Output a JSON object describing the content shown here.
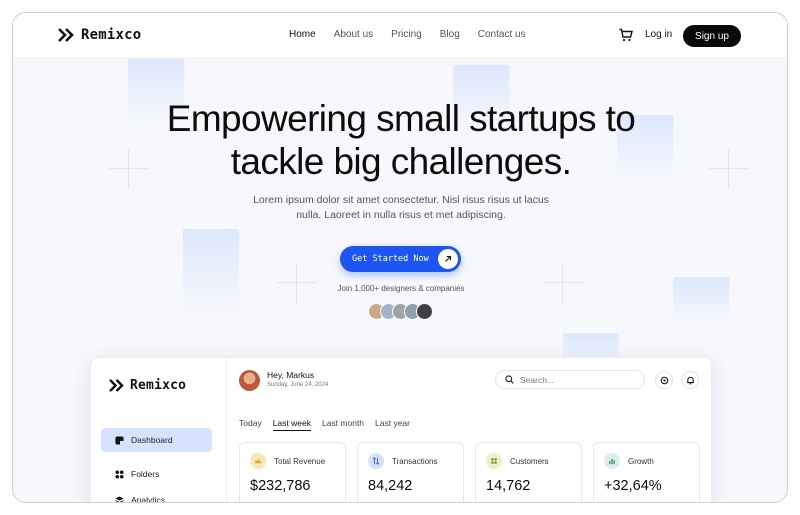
{
  "brand": {
    "name": "Remixco"
  },
  "nav": {
    "links": [
      "Home",
      "About us",
      "Pricing",
      "Blog",
      "Contact us"
    ],
    "active": "Home",
    "cart_icon": "cart-icon",
    "login": "Log in",
    "signup": "Sign up"
  },
  "hero": {
    "title_line1": "Empowering small startups to",
    "title_line2": "tackle big challenges.",
    "subtitle_line1": "Lorem ipsum dolor sit amet consectetur. Nisl risus risus ut lacus",
    "subtitle_line2": "nulla. Laoreet in nulla risus et met adipiscing.",
    "cta": "Get Started Now",
    "cta_icon": "arrow-up-right-icon",
    "join_text": "Join 1,000+ designers & companies",
    "avatar_count": 5
  },
  "dashboard": {
    "brand": "Remixco",
    "user": {
      "greeting": "Hey, Markus",
      "date": "Sunday, June 24, 2024"
    },
    "search_placeholder": "Search...",
    "sidebar": [
      {
        "label": "Dashboard",
        "icon": "dashboard-icon",
        "active": true
      },
      {
        "label": "Folders",
        "icon": "folders-icon",
        "active": false
      },
      {
        "label": "Analytics",
        "icon": "analytics-icon",
        "active": false
      }
    ],
    "tabs": [
      "Today",
      "Last week",
      "Last month",
      "Last year"
    ],
    "active_tab": "Last week",
    "stats": [
      {
        "label": "Total Revenue",
        "value": "$232,786",
        "icon": "revenue-icon",
        "color": "#f7e7b5"
      },
      {
        "label": "Transactions",
        "value": "84,242",
        "icon": "transactions-icon",
        "color": "#d5e1fb"
      },
      {
        "label": "Customers",
        "value": "14,762",
        "icon": "customers-icon",
        "color": "#eef0c9"
      },
      {
        "label": "Growth",
        "value": "+32,64%",
        "icon": "growth-icon",
        "color": "#dcefe6"
      }
    ]
  },
  "colors": {
    "accent": "#1d55f2",
    "dark": "#0b0b0b",
    "active_bg": "#d5e3ff"
  }
}
